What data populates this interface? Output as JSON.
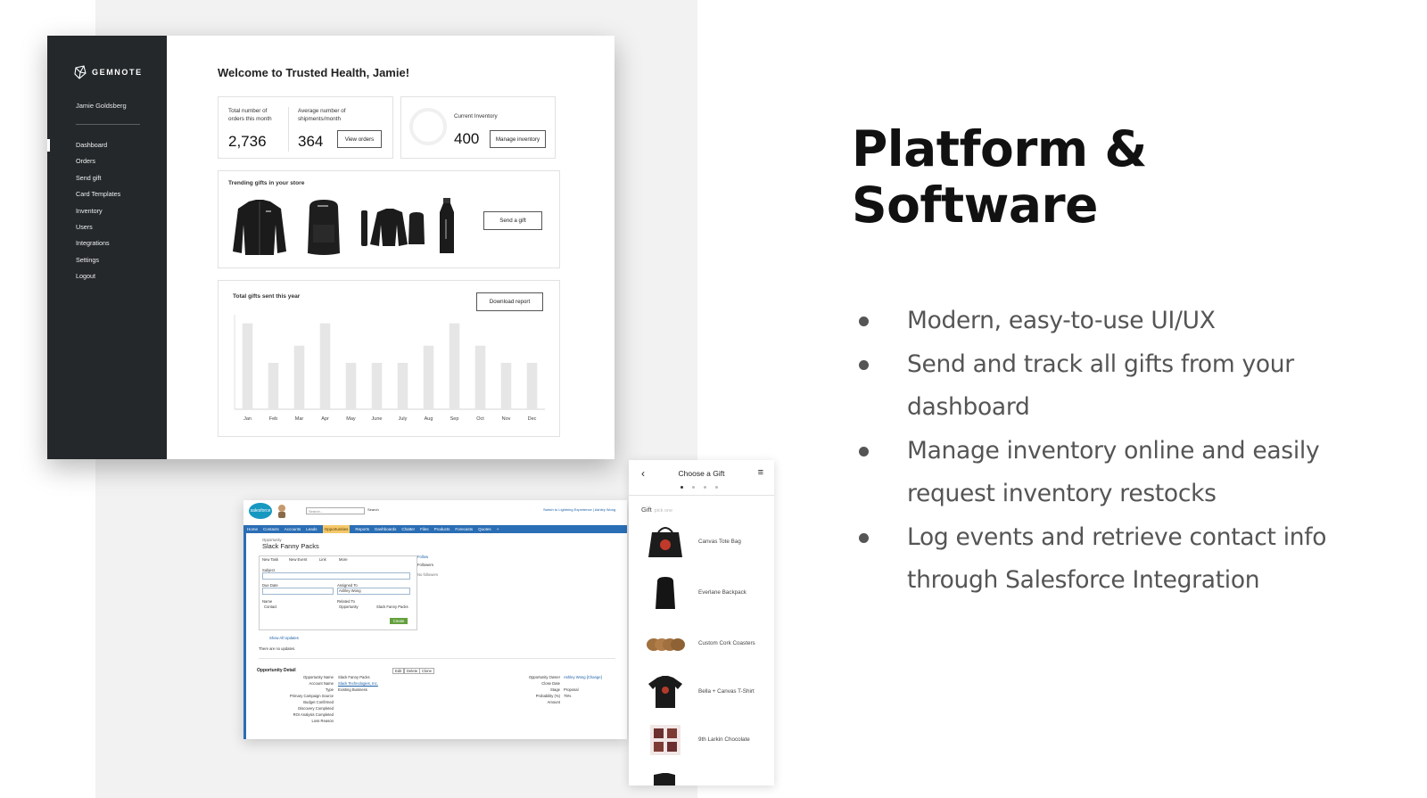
{
  "dashboard": {
    "brand": "GEMNOTE",
    "user_name": "Jamie Goldsberg",
    "nav": [
      "Dashboard",
      "Orders",
      "Send gift",
      "Card Templates",
      "Inventory",
      "Users",
      "Integrations",
      "Settings",
      "Logout"
    ],
    "active_nav": "Dashboard",
    "welcome": "Welcome to Trusted Health, Jamie!",
    "stats": {
      "orders_label": "Total number of orders this month",
      "orders_value": "2,736",
      "shipments_label": "Average number of shipments/month",
      "shipments_value": "364",
      "view_orders_button": "View orders"
    },
    "inventory": {
      "label": "Current Inventory",
      "value": "400",
      "manage_button": "Manage inventory"
    },
    "trending": {
      "title": "Trending gifts in your store",
      "items": [
        "jacket",
        "backpack",
        "bundle",
        "water-bottle"
      ],
      "send_button": "Send a gift"
    },
    "chart_data": {
      "type": "bar",
      "title": "Total gifts sent this year",
      "categories": [
        "Jan",
        "Feb",
        "Mar",
        "Apr",
        "May",
        "June",
        "July",
        "Aug",
        "Sep",
        "Oct",
        "Nov",
        "Dec"
      ],
      "values": [
        5,
        2.7,
        3.7,
        5,
        2.7,
        2.7,
        2.7,
        3.7,
        5,
        3.7,
        2.7,
        2.7
      ],
      "ylim": [
        0,
        5.5
      ],
      "grid": false,
      "bar_color": "#e6e6e6",
      "download_button": "Download report"
    }
  },
  "salesforce": {
    "logo": "salesforce",
    "search_placeholder": "Search...",
    "search_button": "Search",
    "top_links": "Switch to Lightning Experience | Ashley Wong",
    "tabs": [
      "Home",
      "Contacts",
      "Accounts",
      "Leads",
      "Opportunities",
      "Reports",
      "Dashboards",
      "Chatter",
      "Files",
      "Products",
      "Forecasts",
      "Quotes",
      "+"
    ],
    "active_tab": "Opportunities",
    "record_type": "Opportunity",
    "record_title": "Slack Fanny Packs",
    "actions": [
      "New Task",
      "New Event",
      "Link",
      "More"
    ],
    "follow": "Follow",
    "followers": "Followers",
    "no_followers": "No followers",
    "fields": {
      "subject": "Subject",
      "due_date": "Due Date",
      "assigned_to": "Assigned To",
      "assigned_value": "Ashley Wong",
      "name": "Name",
      "name_value": "Contact",
      "related_to": "Related To",
      "related_type": "Opportunity",
      "related_value": "Slack Fanny Packs"
    },
    "create_button": "Create",
    "show_updates": "Show All Updates",
    "no_updates": "There are no updates.",
    "related_links": "Opportunity Detail",
    "detail_buttons": [
      "Edit",
      "Delete",
      "Clone"
    ],
    "detail_rows": [
      [
        "Opportunity Name",
        "Slack Fanny Packs"
      ],
      [
        "Account Name",
        "Slack Technologies, Inc."
      ],
      [
        "Type",
        "Existing Business"
      ],
      [
        "Primary Campaign Source",
        ""
      ],
      [
        "Budget Confirmed",
        ""
      ],
      [
        "Discovery Completed",
        ""
      ],
      [
        "ROI Analysis Completed",
        ""
      ],
      [
        "Loss Reason",
        ""
      ]
    ],
    "detail_right": [
      [
        "Opportunity Owner",
        "Ashley Wong [Change]"
      ],
      [
        "Close Date",
        ""
      ],
      [
        "Stage",
        "Proposal"
      ],
      [
        "Probability (%)",
        "75%"
      ],
      [
        "Amount",
        ""
      ]
    ]
  },
  "mobile": {
    "title": "Choose a Gift",
    "gift_label": "Gift",
    "gift_sub": "pick one",
    "items": [
      "Canvas Tote Bag",
      "Everlane Backpack",
      "Custom Cork Coasters",
      "Bella + Canvas T-Shirt",
      "9th Larkin Chocolate"
    ]
  },
  "slide": {
    "headline_line1": "Platform &",
    "headline_line2": "Software",
    "bullets": [
      "Modern, easy-to-use UI/UX",
      "Send and track all gifts from your dashboard",
      "Manage inventory online and easily request inventory restocks",
      "Log events and retrieve contact info through Salesforce Integration"
    ]
  }
}
